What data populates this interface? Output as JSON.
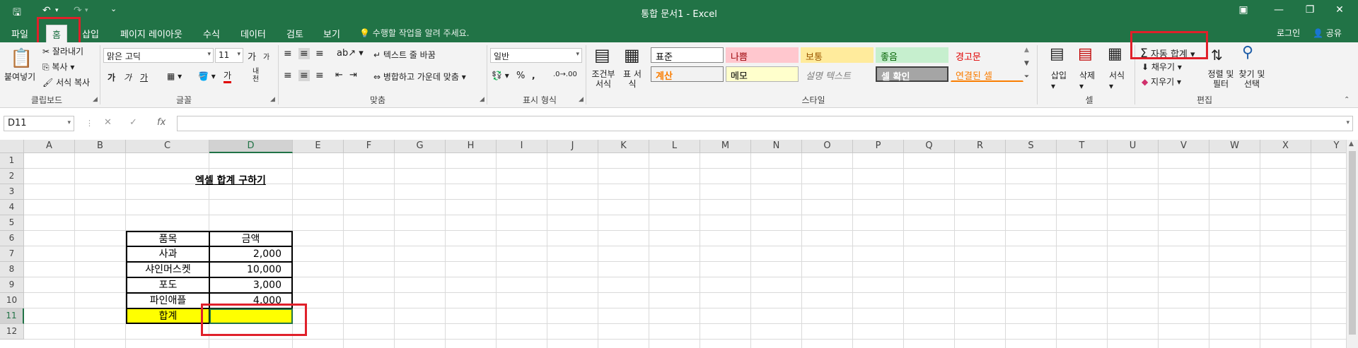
{
  "titlebar": {
    "title": "통합 문서1 - Excel",
    "qa": {
      "save": "🖫",
      "undo": "↶",
      "redo": "↷",
      "customize": "⌄"
    },
    "window_controls": {
      "ribbon_display": "▣",
      "minimize": "—",
      "restore": "❐",
      "close": "✕"
    }
  },
  "tabs": [
    {
      "label": "파일"
    },
    {
      "label": "홈"
    },
    {
      "label": "삽입"
    },
    {
      "label": "페이지 레이아웃"
    },
    {
      "label": "수식"
    },
    {
      "label": "데이터"
    },
    {
      "label": "검토"
    },
    {
      "label": "보기"
    }
  ],
  "tellme": "수행할 작업을 알려 주세요.",
  "login": "로그인",
  "share": "공유",
  "ribbon": {
    "clipboard": {
      "label": "클립보드",
      "paste": "붙여넣기",
      "cut": "잘라내기",
      "copy": "복사",
      "format_painter": "서식 복사"
    },
    "font": {
      "label": "글꼴",
      "name": "맑은 고딕",
      "size": "11",
      "grow": "가",
      "shrink": "가",
      "bold": "가",
      "italic": "가",
      "underline": "가",
      "color_a": "가",
      "phonetic": "내천"
    },
    "alignment": {
      "label": "맞춤",
      "wrap": "텍스트 줄 바꿈",
      "merge": "병합하고 가운데 맞춤"
    },
    "number": {
      "label": "표시 형식",
      "format": "일반",
      "percent": "%"
    },
    "styles": {
      "label": "스타일",
      "conditional": "조건부 서식",
      "table": "표 서식",
      "cells": [
        {
          "text": "표준",
          "bg": "#ffffff",
          "fg": "#000000",
          "border": "#888888"
        },
        {
          "text": "나쁨",
          "bg": "#ffc7ce",
          "fg": "#9c0006",
          "border": "#ffc7ce"
        },
        {
          "text": "보통",
          "bg": "#ffeb9c",
          "fg": "#9c5700",
          "border": "#ffeb9c"
        },
        {
          "text": "좋음",
          "bg": "#c6efce",
          "fg": "#006100",
          "border": "#c6efce"
        },
        {
          "text": "경고문",
          "bg": "#f3f3f3",
          "fg": "#e00000",
          "border": "#f3f3f3"
        },
        {
          "text": "계산",
          "bg": "#f2f2f2",
          "fg": "#fa7d00",
          "border": "#7f7f7f"
        },
        {
          "text": "메모",
          "bg": "#ffffcc",
          "fg": "#000000",
          "border": "#b2b2b2"
        },
        {
          "text": "설명 텍스트",
          "bg": "#f3f3f3",
          "fg": "#7f7f7f",
          "border": "#f3f3f3"
        },
        {
          "text": "셀 확인",
          "bg": "#a5a5a5",
          "fg": "#ffffff",
          "border": "#3f3f3f"
        },
        {
          "text": "연결된 셀",
          "bg": "#f3f3f3",
          "fg": "#fa7d00",
          "border": "#f3f3f3"
        }
      ]
    },
    "cells": {
      "label": "셀",
      "insert": "삽입",
      "delete": "삭제",
      "format": "서식"
    },
    "editing": {
      "label": "편집",
      "autosum": "자동 합계",
      "fill": "채우기",
      "clear": "지우기",
      "sort": "정렬 및 필터",
      "find": "찾기 및 선택"
    }
  },
  "formula_bar": {
    "name_box": "D11",
    "cancel": "✕",
    "enter": "✓",
    "fx": "fx",
    "content": ""
  },
  "grid": {
    "columns": [
      "A",
      "B",
      "C",
      "D",
      "E",
      "F",
      "G",
      "H",
      "I",
      "J",
      "K",
      "L",
      "M",
      "N",
      "O",
      "P",
      "Q",
      "R",
      "S",
      "T",
      "U",
      "V",
      "W",
      "X",
      "Y"
    ],
    "rows": [
      "1",
      "2",
      "3",
      "4",
      "5",
      "6",
      "7",
      "8",
      "9",
      "10",
      "11",
      "12"
    ],
    "selected_column": "D",
    "selected_row": "11",
    "title": "엑셀 합계 구하기",
    "header": {
      "item": "품목",
      "amount": "금액"
    },
    "items": [
      {
        "name": "사과",
        "amount": "2,000"
      },
      {
        "name": "샤인머스켓",
        "amount": "10,000"
      },
      {
        "name": "포도",
        "amount": "3,000"
      },
      {
        "name": "파인애플",
        "amount": "4,000"
      }
    ],
    "total_label": "합계",
    "total_value": "",
    "total_bg": "#ffff00"
  },
  "colors": {
    "accent": "#217346",
    "highlight": "#e0202a"
  }
}
